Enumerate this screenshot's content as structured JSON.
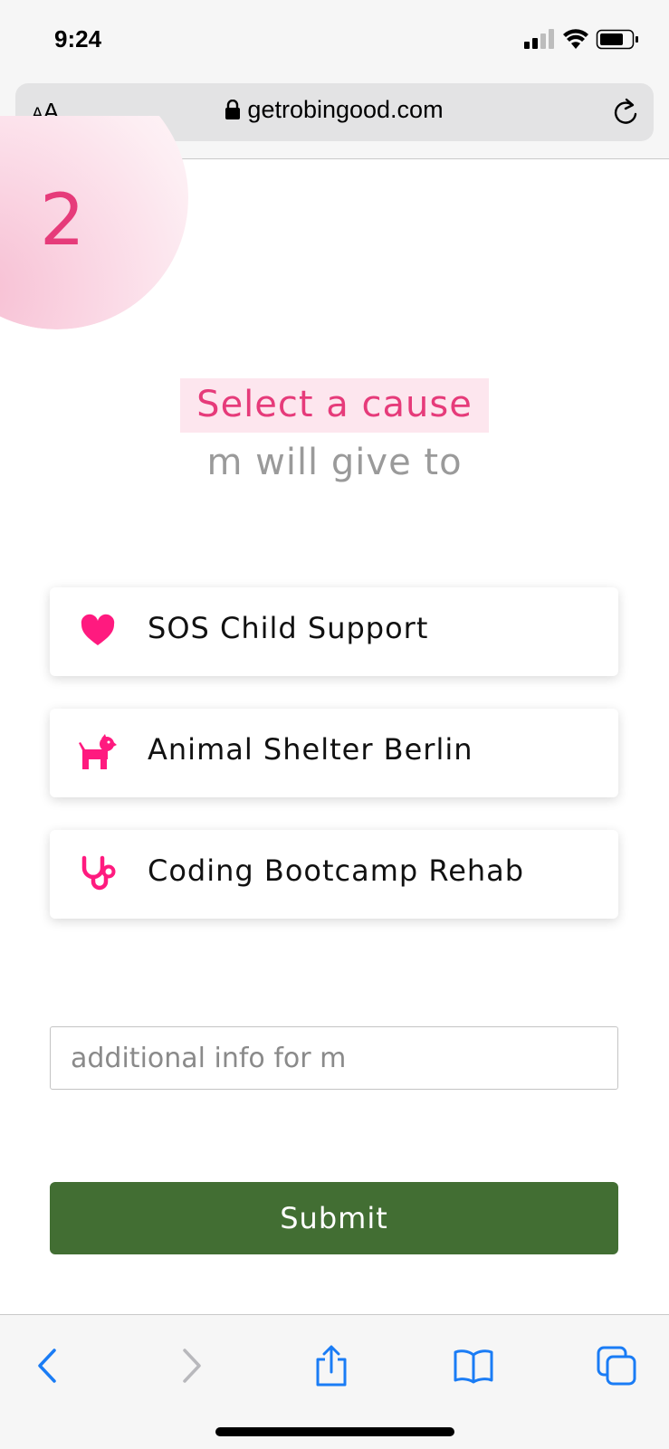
{
  "status_bar": {
    "time": "9:24",
    "icons": [
      "signal-icon",
      "wifi-icon",
      "battery-icon"
    ]
  },
  "browser": {
    "text_size_label_small": "A",
    "text_size_label_large": "A",
    "url": "getrobingood.com",
    "icons": [
      "lock-icon",
      "reload-icon"
    ]
  },
  "page": {
    "step_number": "2",
    "heading": "Select a cause",
    "subheading": "m will give to",
    "causes": [
      {
        "label": "SOS Child Support",
        "icon": "heart-icon"
      },
      {
        "label": "Animal Shelter Berlin",
        "icon": "dog-icon"
      },
      {
        "label": "Coding Bootcamp Rehab",
        "icon": "stethoscope-icon"
      }
    ],
    "info_input": {
      "placeholder": "additional info for m",
      "value": ""
    },
    "submit_label": "Submit"
  },
  "toolbar": {
    "icons": [
      "back-icon",
      "forward-icon",
      "share-icon",
      "bookmarks-icon",
      "tabs-icon"
    ]
  },
  "colors": {
    "accent_pink": "#e63b7a",
    "icon_pink": "#ff1a7f",
    "submit_green": "#426e33",
    "safari_blue": "#1a7cf5"
  }
}
